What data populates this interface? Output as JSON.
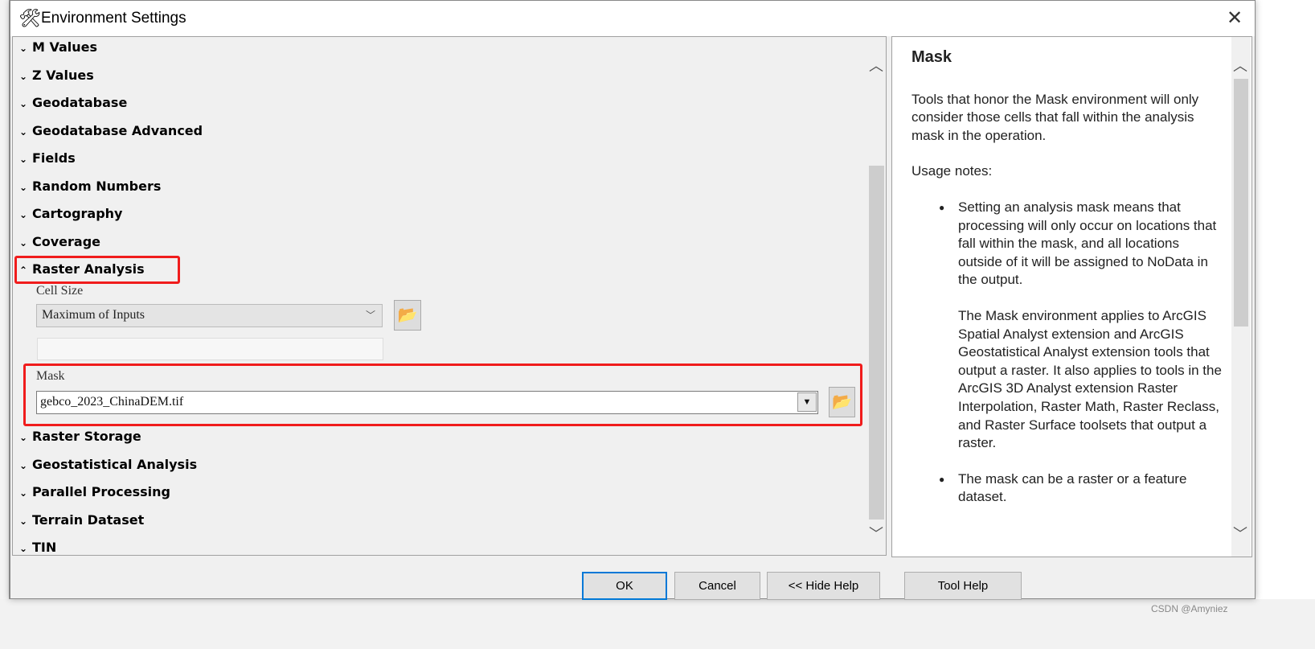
{
  "window": {
    "title": "Environment Settings",
    "icon": "tools-icon",
    "close": "✕"
  },
  "sections_top": [
    {
      "label": "M Values",
      "expanded": false
    },
    {
      "label": "Z Values",
      "expanded": false
    },
    {
      "label": "Geodatabase",
      "expanded": false
    },
    {
      "label": "Geodatabase Advanced",
      "expanded": false
    },
    {
      "label": "Fields",
      "expanded": false
    },
    {
      "label": "Random Numbers",
      "expanded": false
    },
    {
      "label": "Cartography",
      "expanded": false
    },
    {
      "label": "Coverage",
      "expanded": false
    },
    {
      "label": "Raster Analysis",
      "expanded": true
    }
  ],
  "raster_analysis": {
    "cell_size_label": "Cell Size",
    "cell_size_value": "Maximum of Inputs",
    "cell_size_extra": "",
    "mask_label": "Mask",
    "mask_value": "gebco_2023_ChinaDEM.tif"
  },
  "sections_bottom": [
    {
      "label": "Raster Storage",
      "expanded": false
    },
    {
      "label": "Geostatistical Analysis",
      "expanded": false
    },
    {
      "label": "Parallel Processing",
      "expanded": false
    },
    {
      "label": "Terrain Dataset",
      "expanded": false
    },
    {
      "label": "TIN",
      "expanded": false
    }
  ],
  "help": {
    "title": "Mask",
    "intro": "Tools that honor the Mask environment will only consider those cells that fall within the analysis mask in the operation.",
    "usage": "Usage notes:",
    "bullets": [
      {
        "text": "Setting an analysis mask means that processing will only occur on locations that fall within the mask, and all locations outside of it will be assigned to NoData in the output.",
        "extra": "The Mask environment applies to ArcGIS Spatial Analyst extension and ArcGIS Geostatistical Analyst extension tools that output a raster. It also applies to tools in the ArcGIS 3D Analyst extension Raster Interpolation, Raster Math, Raster Reclass, and Raster Surface toolsets that output a raster."
      },
      {
        "text": "The mask can be a raster or a feature dataset."
      }
    ]
  },
  "buttons": {
    "ok": "OK",
    "cancel": "Cancel",
    "hide_help": "<< Hide Help",
    "tool_help": "Tool Help"
  },
  "watermark": "CSDN @Amyniez",
  "colors": {
    "highlight": "#f01c1c",
    "default_button": "#0078d7"
  }
}
